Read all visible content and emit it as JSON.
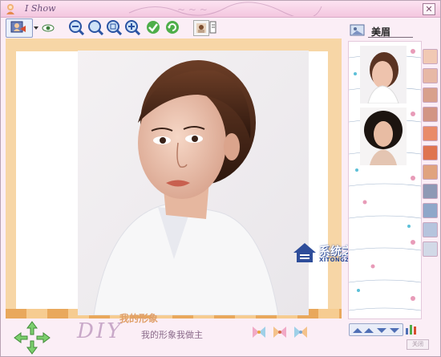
{
  "window": {
    "title": "I Show",
    "close_label": "✕"
  },
  "toolbar": {
    "buttons": [
      {
        "name": "open-image-button",
        "icon": "photo-frame-icon"
      },
      {
        "name": "dropdown-arrow",
        "icon": "chevron-down-icon"
      },
      {
        "name": "preview-button",
        "icon": "eye-icon"
      },
      {
        "name": "zoom-out-button",
        "icon": "zoom-out-icon"
      },
      {
        "name": "zoom-in-button",
        "icon": "zoom-in-icon"
      },
      {
        "name": "zoom-fit-button",
        "icon": "zoom-fit-icon"
      },
      {
        "name": "zoom-add-button",
        "icon": "zoom-plus-icon"
      },
      {
        "name": "confirm-button",
        "icon": "check-icon"
      },
      {
        "name": "refresh-button",
        "icon": "refresh-icon"
      },
      {
        "name": "portrait-button",
        "icon": "portrait-icon"
      },
      {
        "name": "info-button",
        "icon": "note-icon"
      }
    ]
  },
  "side_panel": {
    "tab_label": "美眉",
    "tab_icon": "folder-image-icon",
    "categories": [
      "hairstyle-icon",
      "face-icon",
      "makeup-icon",
      "lips-icon",
      "eyes-icon",
      "accessory-icon",
      "glasses-icon",
      "hat-icon",
      "clothes-icon",
      "background-icon",
      "photo-icon",
      "document-icon"
    ]
  },
  "watermark": {
    "brand": "系统之家",
    "url": "XITONGZHIJIA.NET"
  },
  "footer": {
    "diy_text": "DIY",
    "slogan_top": "我的形象",
    "slogan": "我的形象我做主",
    "close_button": "关闭"
  },
  "colors": {
    "window_bg": "#fbeef6",
    "frame": "#f7d6a6",
    "accent": "#e9a85c",
    "titlebar": "#f3c6df"
  }
}
